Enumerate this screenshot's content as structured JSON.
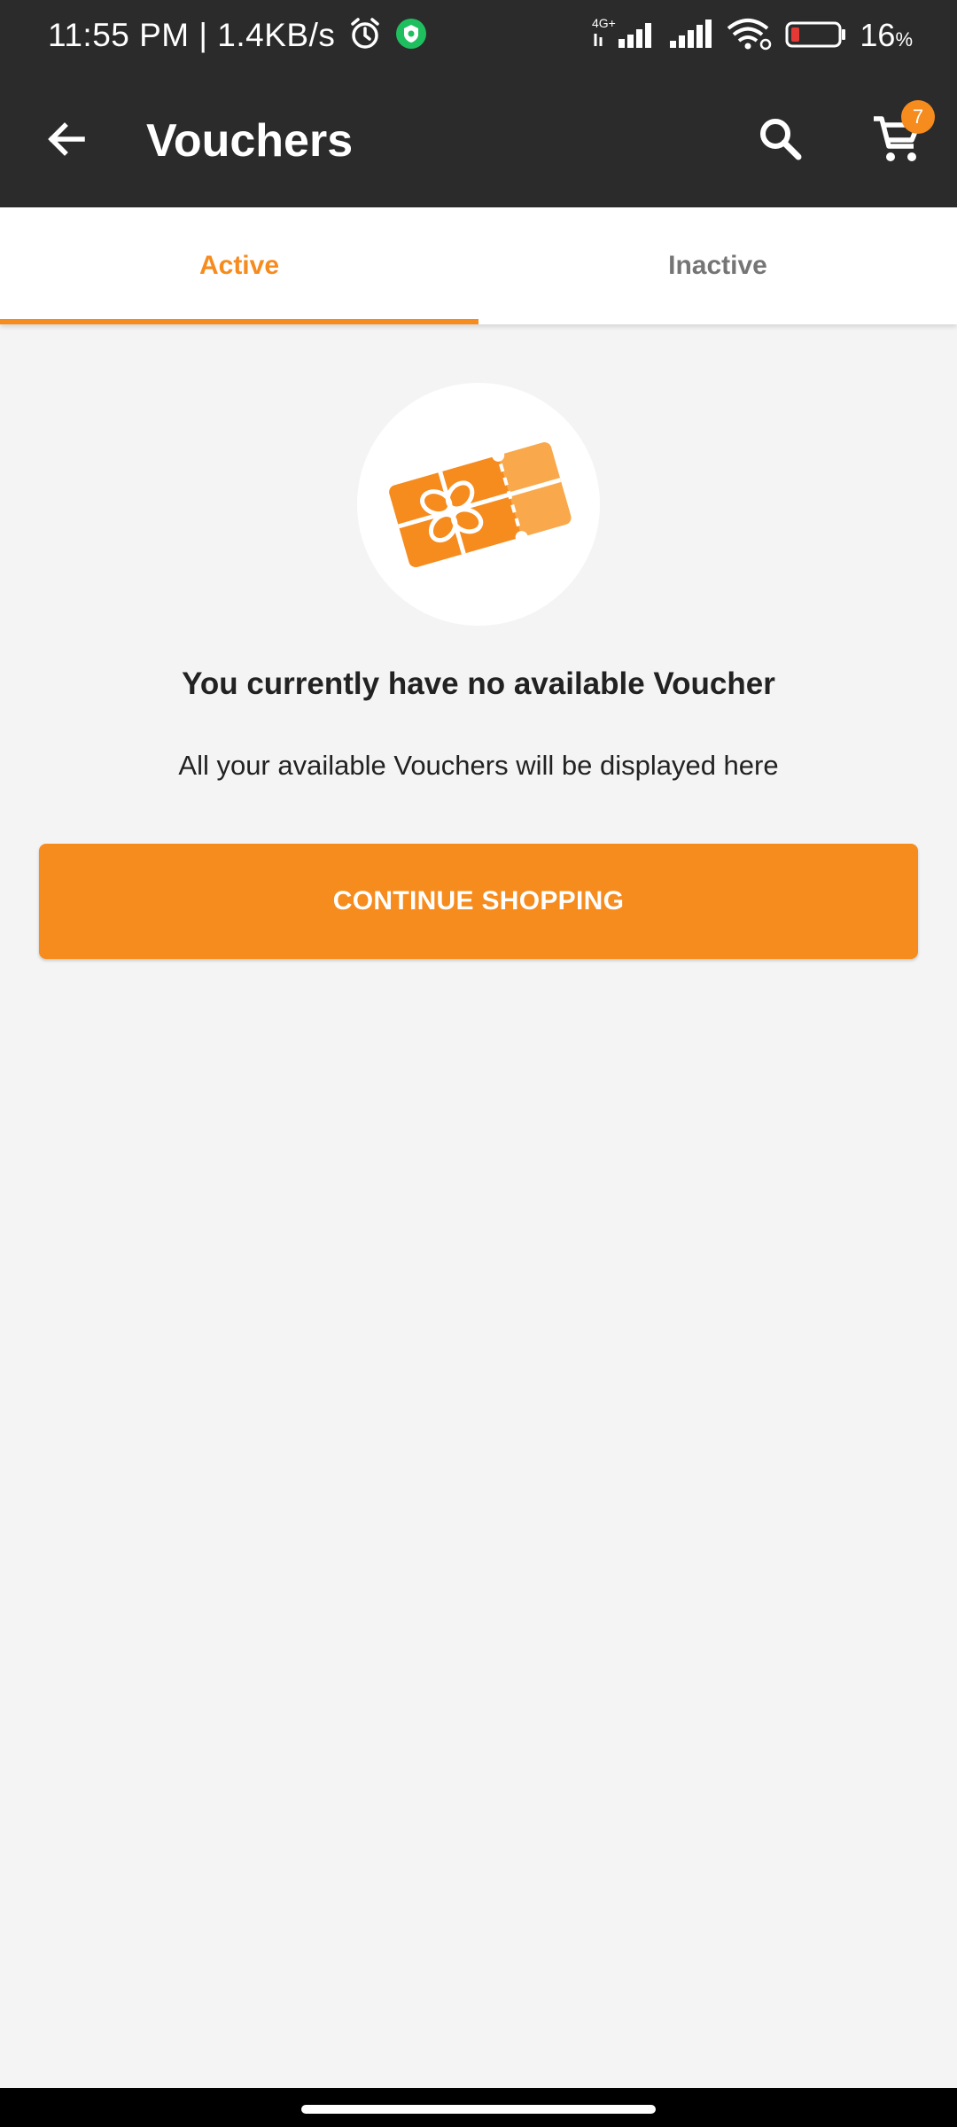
{
  "status_bar": {
    "time": "11:55 PM | 1.4KB/s",
    "network_label": "4G+",
    "battery_percent": "16",
    "battery_unit": "%"
  },
  "app_bar": {
    "title": "Vouchers",
    "cart_count": "7",
    "icons": [
      "back-arrow-icon",
      "search-icon",
      "cart-icon"
    ]
  },
  "tabs": [
    {
      "label": "Active",
      "selected": true
    },
    {
      "label": "Inactive",
      "selected": false
    }
  ],
  "empty_state": {
    "title": "You currently have no available Voucher",
    "subtitle": "All your available Vouchers will be displayed here",
    "icon": "voucher-ticket-icon"
  },
  "cta": {
    "label": "CONTINUE SHOPPING"
  },
  "colors": {
    "accent": "#f68b1e",
    "appbar": "#2b2b2b",
    "background": "#f4f4f4"
  }
}
